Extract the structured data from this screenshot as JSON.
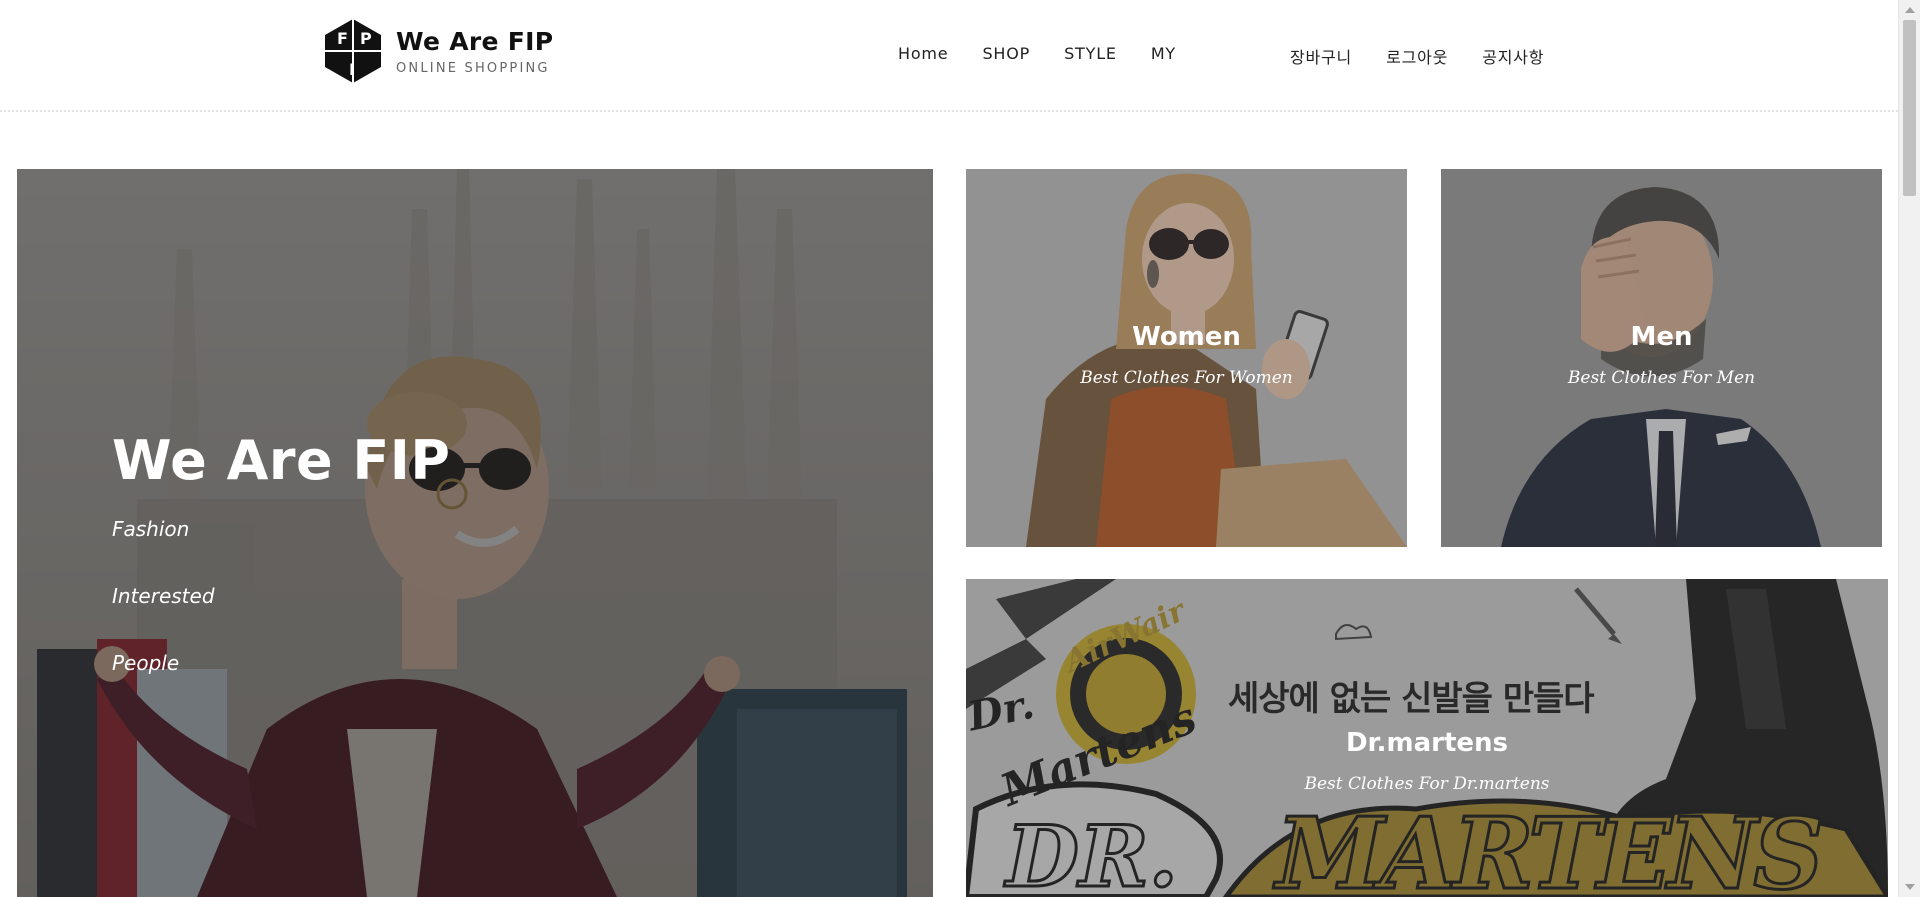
{
  "header": {
    "logo_title": "We Are FIP",
    "logo_subtitle": "ONLINE SHOPPING",
    "logo_mark": "FIP",
    "nav_main": [
      "Home",
      "SHOP",
      "STYLE",
      "MY"
    ],
    "nav_user": [
      "장바구니",
      "로그아웃",
      "공지사항"
    ]
  },
  "hero": {
    "title": "We Are FIP",
    "lines": [
      "Fashion",
      "Interested",
      "People"
    ]
  },
  "cards": {
    "women": {
      "title": "Women",
      "subtitle": "Best Clothes For Women"
    },
    "men": {
      "title": "Men",
      "subtitle": "Best Clothes For Men"
    },
    "brand": {
      "title": "Dr.martens",
      "subtitle": "Best Clothes For Dr.martens",
      "tagline": "세상에 없는 신발을 만들다",
      "logo_words": [
        "Dr.",
        "AirWair",
        "Martens",
        "DR.",
        "MARTENS"
      ]
    }
  },
  "colors": {
    "overlay": "#3a3a3a",
    "accent_gold": "#b8962a",
    "text_dark": "#222222"
  }
}
